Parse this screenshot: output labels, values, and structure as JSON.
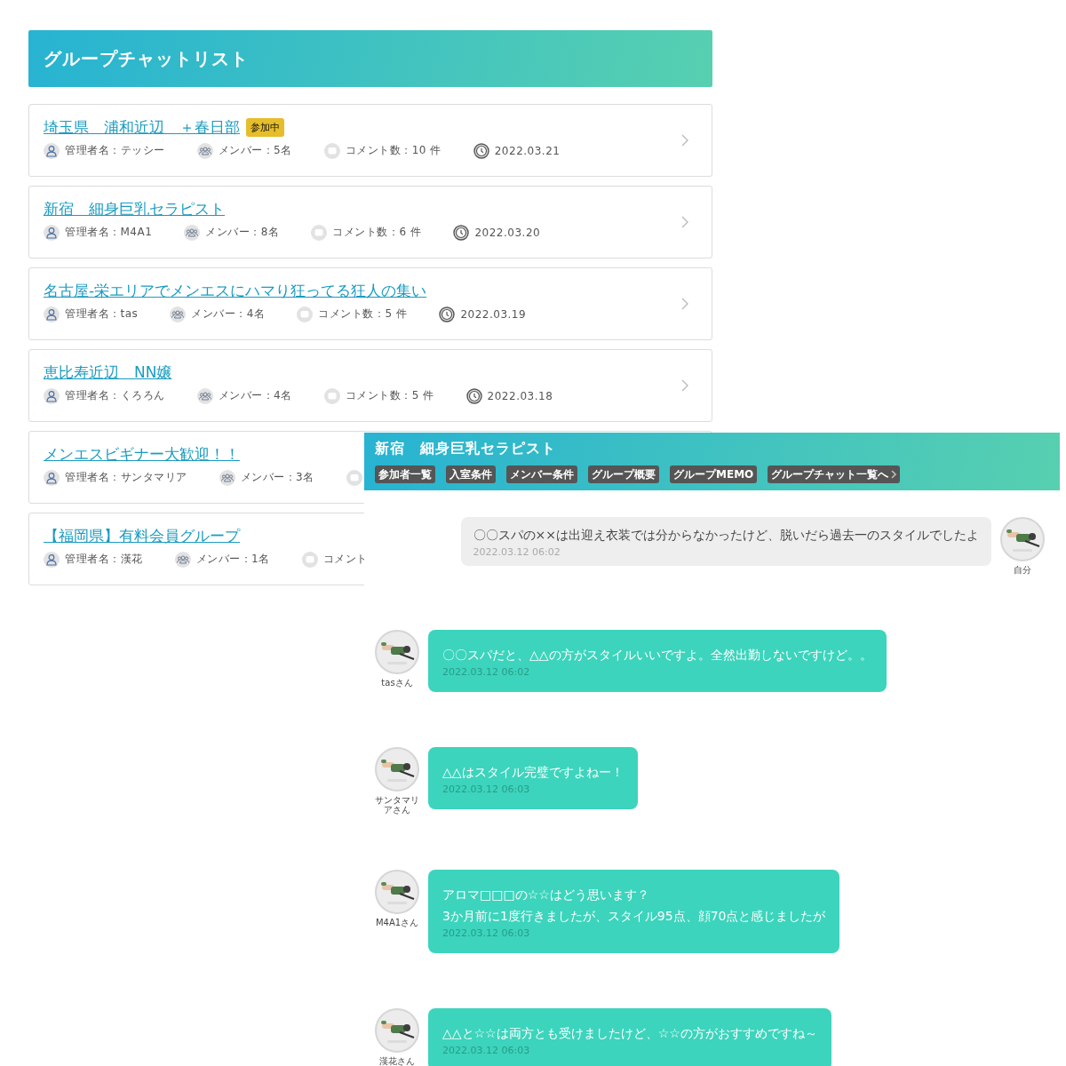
{
  "page_title": "グループチャットリスト",
  "groups": [
    {
      "title": "埼玉県　浦和近辺　＋春日部",
      "badge": "参加中",
      "admin": "管理者名：テッシー",
      "members": "メンバー：5名",
      "comments": "コメント数：10 件",
      "date": "2022.03.21"
    },
    {
      "title": "新宿　細身巨乳セラピスト",
      "admin": "管理者名：M4A1",
      "members": "メンバー：8名",
      "comments": "コメント数：6 件",
      "date": "2022.03.20"
    },
    {
      "title": "名古屋-栄エリアでメンエスにハマり狂ってる狂人の集い",
      "admin": "管理者名：tas",
      "members": "メンバー：4名",
      "comments": "コメント数：5 件",
      "date": "2022.03.19"
    },
    {
      "title": "恵比寿近辺　NN嬢",
      "admin": "管理者名：くろろん",
      "members": "メンバー：4名",
      "comments": "コメント数：5 件",
      "date": "2022.03.18"
    },
    {
      "title": "メンエスビギナー大歓迎！！",
      "admin": "管理者名：サンタマリア",
      "members": "メンバー：3名"
    },
    {
      "title": "【福岡県】有料会員グループ",
      "admin": "管理者名：漢花",
      "members": "メンバー：1名",
      "comments": "コメント"
    }
  ],
  "chat": {
    "title": "新宿　細身巨乳セラピスト",
    "tabs": [
      {
        "label": "参加者一覧",
        "kind": "section"
      },
      {
        "label": "入室条件",
        "kind": "section"
      },
      {
        "label": "メンバー条件",
        "kind": "section"
      },
      {
        "label": "グループ概要",
        "kind": "section"
      },
      {
        "label": "グループMEMO",
        "kind": "section"
      },
      {
        "label": "グループチャット一覧へ",
        "kind": "back"
      }
    ],
    "messages": [
      {
        "kind": "self",
        "text": "〇〇スパの××は出迎え衣装では分からなかったけど、脱いだら過去一のスタイルでしたよ",
        "time": "2022.03.12 06:02",
        "sender": "自分"
      },
      {
        "kind": "other",
        "text": "〇〇スパだと、△△の方がスタイルいいですよ。全然出勤しないですけど。。",
        "time": "2022.03.12 06:02",
        "sender": "tasさん"
      },
      {
        "kind": "other",
        "text": "△△はスタイル完璧ですよねー！",
        "time": "2022.03.12 06:03",
        "sender": "サンタマリアさん"
      },
      {
        "kind": "other",
        "text": "アロマ□□□の☆☆はどう思います？\n3か月前に1度行きましたが、スタイル95点、顔70点と感じましたが",
        "time": "2022.03.12 06:03",
        "sender": "M4A1さん"
      },
      {
        "kind": "other",
        "text": "△△と☆☆は両方とも受けましたけど、☆☆の方がおすすめですね～",
        "time": "2022.03.12 06:03",
        "sender": "漢花さん"
      }
    ]
  }
}
